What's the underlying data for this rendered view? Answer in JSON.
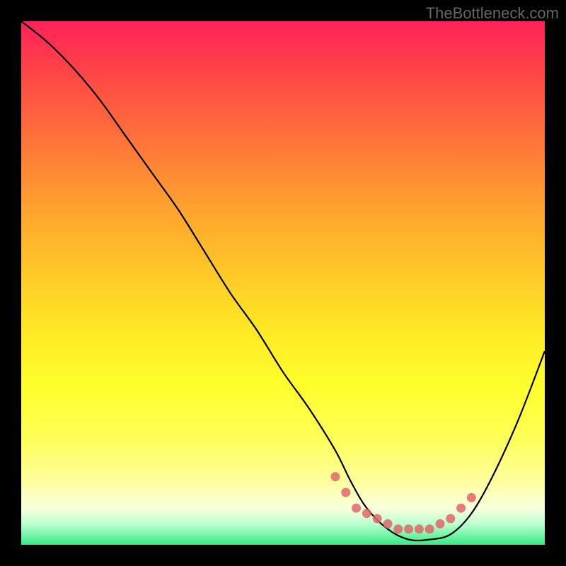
{
  "watermark": "TheBottleneck.com",
  "chart_data": {
    "type": "line",
    "title": "",
    "xlabel": "",
    "ylabel": "",
    "xlim": [
      0,
      100
    ],
    "ylim": [
      0,
      100
    ],
    "series": [
      {
        "name": "bottleneck-curve",
        "x": [
          0,
          5,
          10,
          15,
          20,
          25,
          30,
          35,
          40,
          45,
          50,
          55,
          60,
          63,
          66,
          70,
          74,
          78,
          82,
          86,
          90,
          95,
          100
        ],
        "y": [
          100,
          96,
          91,
          85,
          78,
          71,
          64,
          56,
          48,
          41,
          33,
          26,
          18,
          12,
          7,
          3,
          1,
          1,
          2,
          6,
          13,
          24,
          37
        ]
      }
    ],
    "markers": {
      "name": "highlight-dots",
      "x": [
        60,
        62,
        64,
        66,
        68,
        70,
        72,
        74,
        76,
        78,
        80,
        82,
        84,
        86
      ],
      "y": [
        13,
        10,
        7,
        6,
        5,
        4,
        3,
        3,
        3,
        3,
        4,
        5,
        7,
        9
      ]
    },
    "gradient_stops": [
      {
        "pos": 0.0,
        "color": "#ff215a"
      },
      {
        "pos": 0.1,
        "color": "#ff4646"
      },
      {
        "pos": 0.22,
        "color": "#ff713a"
      },
      {
        "pos": 0.35,
        "color": "#ffa02f"
      },
      {
        "pos": 0.48,
        "color": "#ffc828"
      },
      {
        "pos": 0.6,
        "color": "#ffeb25"
      },
      {
        "pos": 0.7,
        "color": "#ffff2d"
      },
      {
        "pos": 0.8,
        "color": "#ffff5a"
      },
      {
        "pos": 0.88,
        "color": "#ffffa0"
      },
      {
        "pos": 0.93,
        "color": "#faffdc"
      },
      {
        "pos": 0.96,
        "color": "#beffd2"
      },
      {
        "pos": 1.0,
        "color": "#37eb82"
      }
    ]
  }
}
